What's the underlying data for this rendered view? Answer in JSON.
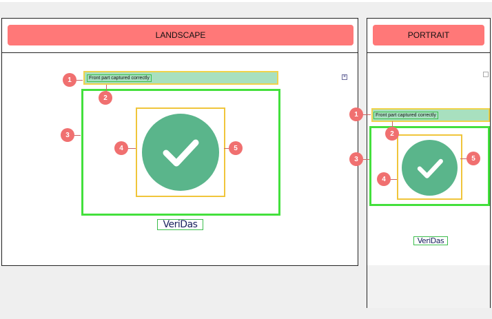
{
  "landscape": {
    "title": "LANDSCAPE"
  },
  "portrait": {
    "title": "PORTRAIT"
  },
  "message": "Front part captured correctly",
  "logo_text": "VeriDas",
  "markers": [
    "1",
    "2",
    "3",
    "4",
    "5"
  ],
  "colors": {
    "header": "#ff7878",
    "check": "#5ab58b",
    "outline_green": "#43e03c",
    "outline_yellow": "#f0c53a",
    "marker": "#f07070"
  }
}
